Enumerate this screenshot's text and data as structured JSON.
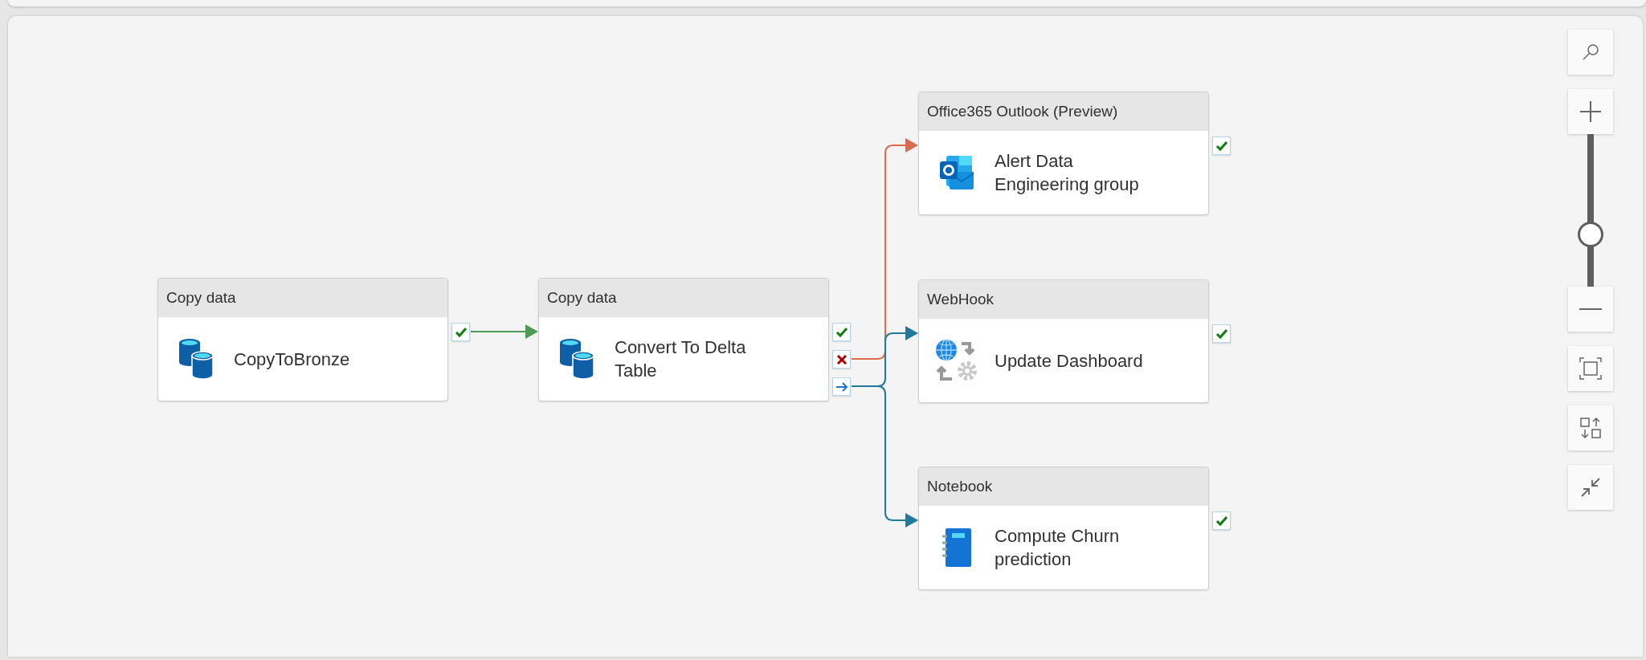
{
  "activities": [
    {
      "type": "Copy data",
      "name": "CopyToBronze",
      "kind": "database",
      "outputs": [
        {
          "kind": "success"
        }
      ]
    },
    {
      "type": "Copy data",
      "name": "Convert To Delta Table",
      "kind": "database",
      "outputs": [
        {
          "kind": "success"
        },
        {
          "kind": "failure"
        },
        {
          "kind": "completion"
        }
      ]
    },
    {
      "type": "Office365 Outlook (Preview)",
      "name": "Alert Data Engineering group",
      "kind": "outlook",
      "outputs": [
        {
          "kind": "success"
        }
      ]
    },
    {
      "type": "WebHook",
      "name": "Update Dashboard",
      "kind": "webhook",
      "outputs": [
        {
          "kind": "success"
        }
      ]
    },
    {
      "type": "Notebook",
      "name": "Compute Churn prediction",
      "kind": "notebook",
      "outputs": [
        {
          "kind": "success"
        }
      ]
    }
  ],
  "zoom": {
    "level": 0.34
  }
}
